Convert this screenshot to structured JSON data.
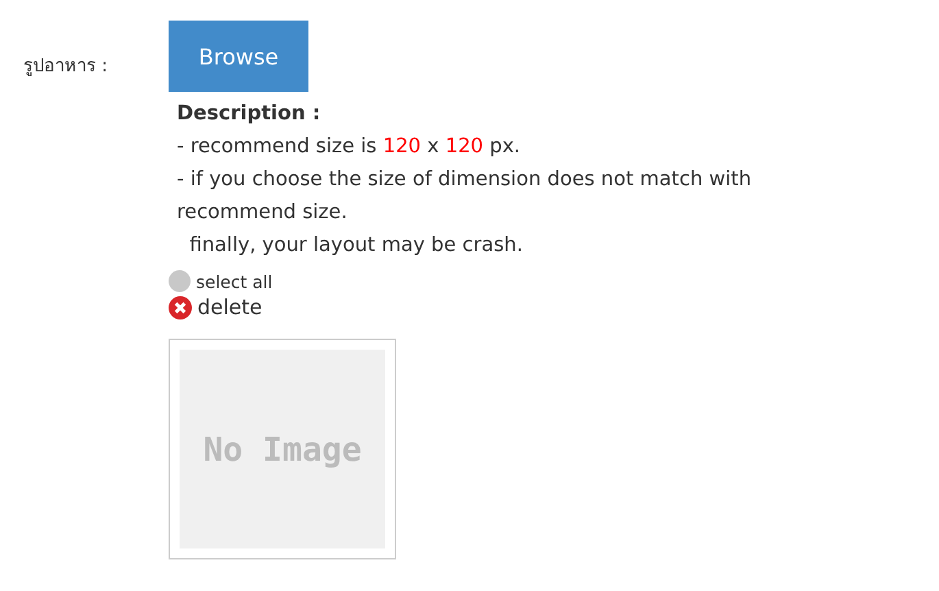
{
  "field_label": "รูปอาหาร :",
  "browse_button": "Browse",
  "description": {
    "title": "Description :",
    "lines": [
      {
        "parts": [
          {
            "text": "- recommend size is ",
            "highlight": false
          },
          {
            "text": "120",
            "highlight": true
          },
          {
            "text": " x ",
            "highlight": false
          },
          {
            "text": "120",
            "highlight": true
          },
          {
            "text": " px.",
            "highlight": false
          }
        ]
      },
      {
        "parts": [
          {
            "text": "- if you choose the size of dimension does not match with recommend size.",
            "highlight": false
          }
        ]
      },
      {
        "parts": [
          {
            "text": "  finally, your layout may be crash.",
            "highlight": false
          }
        ]
      }
    ]
  },
  "select_all": {
    "label": "select all",
    "checked": false
  },
  "delete": {
    "label": "delete"
  },
  "preview": {
    "placeholder_text": "No Image"
  }
}
